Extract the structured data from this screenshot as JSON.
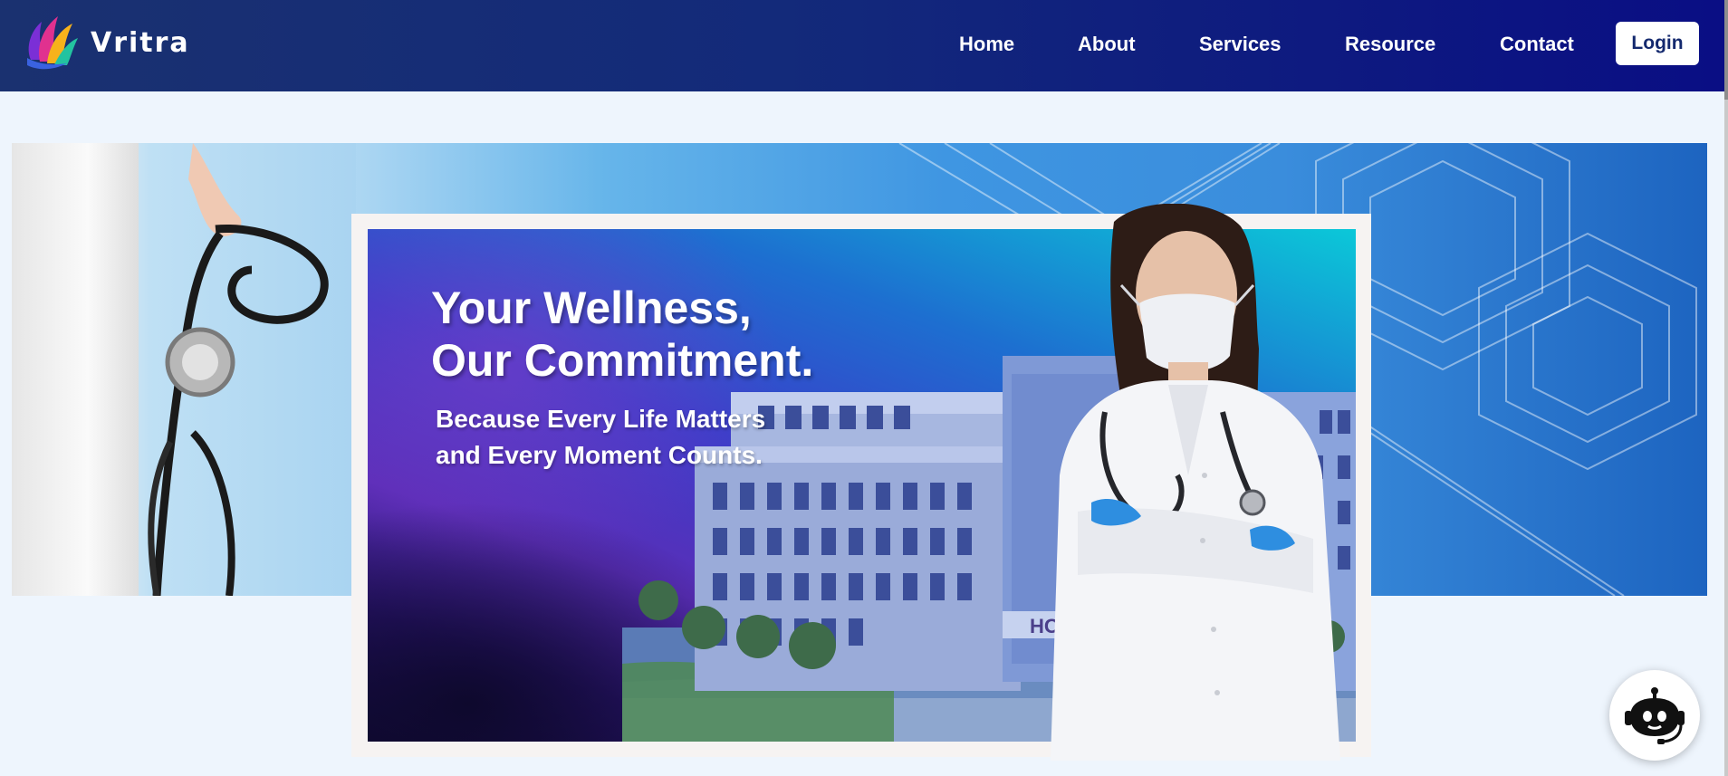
{
  "brand": {
    "name": "Vritra",
    "logo_icon": "vritra-petals-logo-icon"
  },
  "nav": {
    "links": [
      "Home",
      "About",
      "Services",
      "Resource",
      "Contact"
    ],
    "login_label": "Login"
  },
  "hero": {
    "headline_line1": "Your Wellness,",
    "headline_line2": "Our Commitment.",
    "subline_line1": "Because Every Life Matters",
    "subline_line2": "and Every Moment Counts.",
    "hospital_sign": "HOS"
  },
  "chatbot": {
    "icon": "robot-headset-icon"
  },
  "colors": {
    "navbar_start": "#1a3170",
    "navbar_end": "#0a0e84",
    "page_background": "#eef5fd",
    "login_text": "#14296e"
  }
}
